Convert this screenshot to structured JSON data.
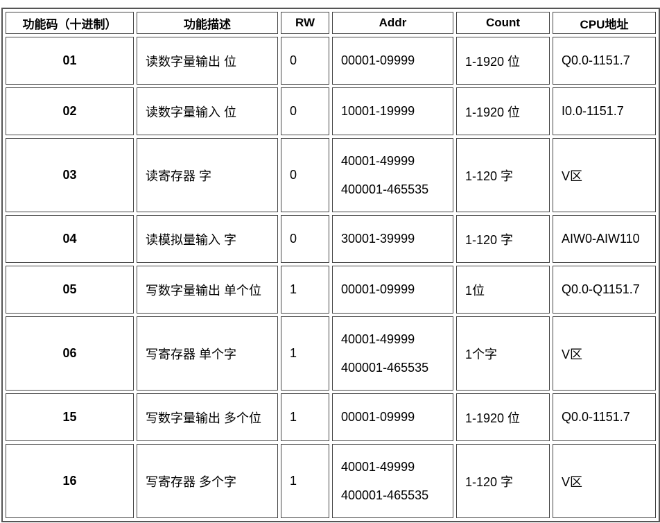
{
  "headers": [
    "功能码（十进制）",
    "功能描述",
    "RW",
    "Addr",
    "Count",
    "CPU地址"
  ],
  "rows": [
    {
      "code": "01",
      "desc": "读数字量输出 位",
      "rw": "0",
      "addr": [
        "00001-09999"
      ],
      "count": "1-1920 位",
      "cpu": "Q0.0-1151.7"
    },
    {
      "code": "02",
      "desc": "读数字量输入 位",
      "rw": "0",
      "addr": [
        "10001-19999"
      ],
      "count": "1-1920 位",
      "cpu": "I0.0-1151.7"
    },
    {
      "code": "03",
      "desc": "读寄存器 字",
      "rw": "0",
      "addr": [
        "40001-49999",
        "400001-465535"
      ],
      "count": "1-120 字",
      "cpu": "V区"
    },
    {
      "code": "04",
      "desc": "读模拟量输入 字",
      "rw": "0",
      "addr": [
        "30001-39999"
      ],
      "count": "1-120 字",
      "cpu": "AIW0-AIW110"
    },
    {
      "code": "05",
      "desc": "写数字量输出 单个位",
      "rw": "1",
      "addr": [
        "00001-09999"
      ],
      "count": "1位",
      "cpu": "Q0.0-Q1151.7"
    },
    {
      "code": "06",
      "desc": "写寄存器 单个字",
      "rw": "1",
      "addr": [
        "40001-49999",
        "400001-465535"
      ],
      "count": "1个字",
      "cpu": "V区"
    },
    {
      "code": "15",
      "desc": "写数字量输出 多个位",
      "rw": "1",
      "addr": [
        "00001-09999"
      ],
      "count": "1-1920 位",
      "cpu": "Q0.0-1151.7"
    },
    {
      "code": "16",
      "desc": "写寄存器 多个字",
      "rw": "1",
      "addr": [
        "40001-49999",
        "400001-465535"
      ],
      "count": "1-120 字",
      "cpu": "V区"
    }
  ]
}
